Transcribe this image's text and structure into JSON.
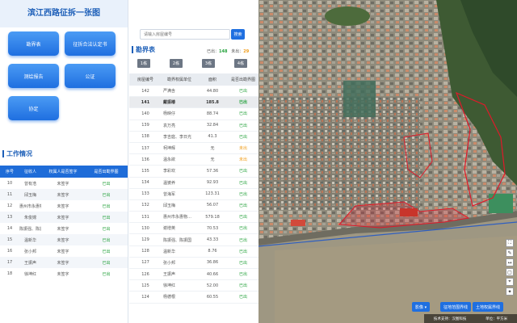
{
  "title": "滨江西路征拆一张图",
  "buttons": [
    "勘界表",
    "征拆合法认定书",
    "测绘报告",
    "公证",
    "协定"
  ],
  "work": {
    "title": "工作情况",
    "headers": [
      "序号",
      "征收人",
      "权属人是否签字",
      "是否出勘界图"
    ],
    "rows": [
      {
        "no": "10",
        "collector": "曾有浩",
        "signed": "未签字",
        "status": "已出"
      },
      {
        "no": "11",
        "collector": "邱玉梅",
        "signed": "未签字",
        "status": "已出"
      },
      {
        "no": "12",
        "collector": "惠州市永惠物业…",
        "signed": "未签字",
        "status": "已出"
      },
      {
        "no": "13",
        "collector": "朱俊嫦",
        "signed": "未签字",
        "status": "已出"
      },
      {
        "no": "14",
        "collector": "陈振强、陈振国",
        "signed": "未签字",
        "status": "已出"
      },
      {
        "no": "15",
        "collector": "温新华",
        "signed": "未签字",
        "status": "已出"
      },
      {
        "no": "16",
        "collector": "张小邦",
        "signed": "未签字",
        "status": "已出"
      },
      {
        "no": "17",
        "collector": "王振声",
        "signed": "未签字",
        "status": "已出"
      },
      {
        "no": "18",
        "collector": "徐坤红",
        "signed": "未签字",
        "status": "已出"
      }
    ]
  },
  "search": {
    "placeholder": "请输入房屋编号",
    "button": "搜索"
  },
  "stats": {
    "done_label": "已出：",
    "done": "148",
    "pending_label": "未出：",
    "pending": "29"
  },
  "land_table": {
    "title": "勘界表",
    "tabs": [
      "1栋",
      "2栋",
      "3栋",
      "4栋"
    ],
    "headers": [
      "房屋编号",
      "勘界权属单位",
      "面积",
      "是否出勘界图"
    ],
    "rows": [
      {
        "no": "142",
        "owner": "严满含",
        "area": "44.80",
        "status": "已出",
        "sel": false
      },
      {
        "no": "141",
        "owner": "戴振椿",
        "area": "185.8",
        "status": "已出",
        "sel": true
      },
      {
        "no": "140",
        "owner": "杨映仔",
        "area": "88.74",
        "status": "已出",
        "sel": false
      },
      {
        "no": "139",
        "owner": "袁万亮",
        "area": "32.84",
        "status": "已出",
        "sel": false
      },
      {
        "no": "138",
        "owner": "李吉庭、李日光",
        "area": "41.3",
        "status": "已出",
        "sel": false
      },
      {
        "no": "137",
        "owner": "柯坤辉",
        "area": "无",
        "status": "未出",
        "sel": false
      },
      {
        "no": "136",
        "owner": "温永欲",
        "area": "无",
        "status": "未出",
        "sel": false
      },
      {
        "no": "135",
        "owner": "李彩欢",
        "area": "57.36",
        "status": "已出",
        "sel": false
      },
      {
        "no": "134",
        "owner": "温婆养",
        "area": "92.93",
        "status": "已出",
        "sel": false
      },
      {
        "no": "133",
        "owner": "曾海军",
        "area": "123.31",
        "status": "已出",
        "sel": false
      },
      {
        "no": "132",
        "owner": "邱玉梅",
        "area": "56.07",
        "status": "已出",
        "sel": false
      },
      {
        "no": "131",
        "owner": "惠州市永惠物…",
        "area": "579.18",
        "status": "已出",
        "sel": false
      },
      {
        "no": "130",
        "owner": "谢增英",
        "area": "70.53",
        "status": "已出",
        "sel": false
      },
      {
        "no": "129",
        "owner": "陈振强、陈振国",
        "area": "43.33",
        "status": "已出",
        "sel": false
      },
      {
        "no": "128",
        "owner": "温新华",
        "area": "8.76",
        "status": "已出",
        "sel": false
      },
      {
        "no": "127",
        "owner": "张小邦",
        "area": "36.86",
        "status": "已出",
        "sel": false
      },
      {
        "no": "126",
        "owner": "王振声",
        "area": "40.66",
        "status": "已出",
        "sel": false
      },
      {
        "no": "125",
        "owner": "徐坤红",
        "area": "52.00",
        "status": "已出",
        "sel": false
      },
      {
        "no": "124",
        "owner": "杨德根",
        "area": "60.55",
        "status": "已出",
        "sel": false
      }
    ]
  },
  "map": {
    "buttons": [
      "影像 ▾",
      "征地范围界线",
      "土地权属界线"
    ],
    "zoom": [
      "⛶",
      "✎",
      "↔",
      "▢",
      "⌖",
      "✦"
    ],
    "status": [
      "技术支持：汉图科技",
      "单位：平方米"
    ]
  }
}
